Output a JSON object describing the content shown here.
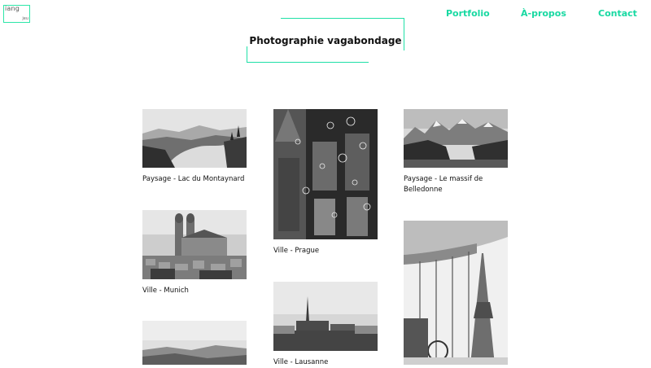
{
  "logo": {
    "text": "iang",
    "mini": "jeu"
  },
  "nav": {
    "portfolio": "Portfolio",
    "apropos": "À-propos",
    "contact": "Contact"
  },
  "page": {
    "title": "Photographie vagabondage"
  },
  "photos": [
    {
      "caption": "Paysage - Lac du Montaynard"
    },
    {
      "caption": "Ville - Prague"
    },
    {
      "caption": "Paysage - Le massif de Belledonne"
    },
    {
      "caption": "Ville - Munich"
    },
    {
      "caption": "Ville - Lausanne"
    }
  ],
  "colors": {
    "accent": "#18d9a2"
  }
}
